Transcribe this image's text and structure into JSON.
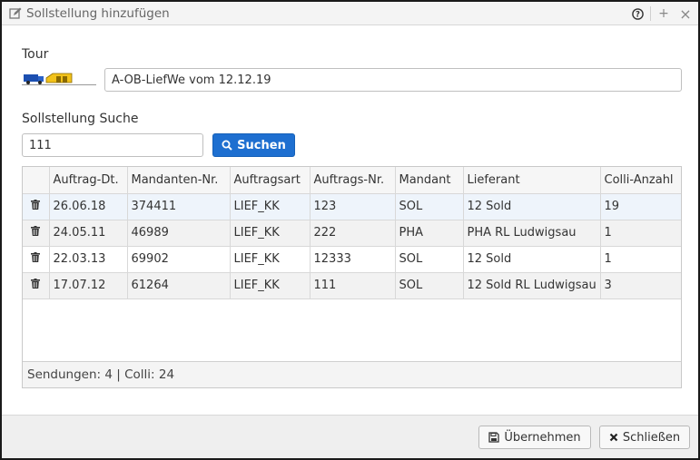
{
  "window": {
    "title": "Sollstellung hinzufügen",
    "help_glyph": "?",
    "max_glyph": "+",
    "close_glyph": "×"
  },
  "tour": {
    "label": "Tour",
    "value": "A-OB-LiefWe vom 12.12.19"
  },
  "search": {
    "label": "Sollstellung Suche",
    "value": "111",
    "button_label": "Suchen"
  },
  "grid": {
    "columns": [
      "Auftrag-Dt.",
      "Mandanten-Nr.",
      "Auftragsart",
      "Auftrags-Nr.",
      "Mandant",
      "Lieferant",
      "Colli-Anzahl"
    ],
    "rows": [
      {
        "date": "26.06.18",
        "client_no": "374411",
        "type": "LIEF_KK",
        "order_no": "123",
        "client": "SOL",
        "supplier": "12 Sold",
        "colli": "19"
      },
      {
        "date": "24.05.11",
        "client_no": "46989",
        "type": "LIEF_KK",
        "order_no": "222",
        "client": "PHA",
        "supplier": "PHA RL Ludwigsau",
        "colli": "1"
      },
      {
        "date": "22.03.13",
        "client_no": "69902",
        "type": "LIEF_KK",
        "order_no": "12333",
        "client": "SOL",
        "supplier": "12 Sold",
        "colli": "1"
      },
      {
        "date": "17.07.12",
        "client_no": "61264",
        "type": "LIEF_KK",
        "order_no": "111",
        "client": "SOL",
        "supplier": "12 Sold RL Ludwigsau",
        "colli": "3"
      }
    ],
    "summary": "Sendungen: 4 | Colli: 24"
  },
  "footer": {
    "accept_label": "Übernehmen",
    "close_label": "Schließen"
  },
  "colors": {
    "primary": "#1e6fd0",
    "selected_row": "#eef4fb",
    "border": "#c9c9c9"
  }
}
